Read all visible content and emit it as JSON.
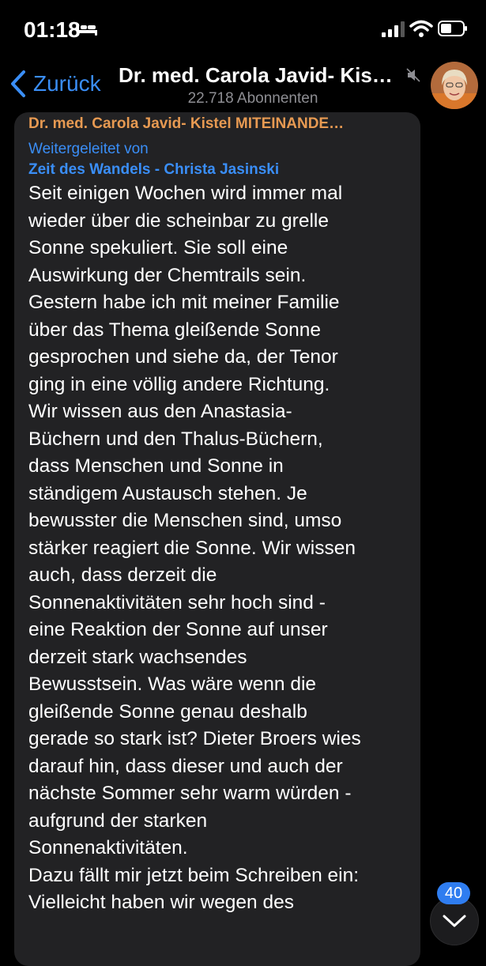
{
  "status_bar": {
    "time": "01:18"
  },
  "header": {
    "back_label": "Zurück",
    "channel_title": "Dr. med. Carola Javid- Kis…",
    "subscribers": "22.718 Abonnenten"
  },
  "message": {
    "sender": "Dr. med. Carola Javid- Kistel MITEINANDE…",
    "forwarded_label": "Weitergeleitet von",
    "forwarded_source": "Zeit des Wandels - Christa Jasinski",
    "lines": [
      "Seit einigen Wochen wird immer mal",
      "wieder über die scheinbar zu grelle",
      "Sonne spekuliert. Sie soll eine",
      "Auswirkung der Chemtrails sein.",
      "Gestern habe ich mit meiner Familie",
      "über das Thema gleißende Sonne",
      "gesprochen und siehe da, der Tenor",
      "ging in eine völlig andere Richtung.",
      "Wir wissen aus den Anastasia-",
      "Büchern und den Thalus-Büchern,",
      "dass Menschen und Sonne in",
      "ständigem Austausch stehen. Je",
      "bewusster die Menschen sind, umso",
      "stärker reagiert die Sonne. Wir wissen",
      "auch, dass derzeit die",
      "Sonnenaktivitäten sehr hoch sind -",
      "eine Reaktion der Sonne auf unser",
      "derzeit stark wachsendes",
      "Bewusstsein. Was wäre wenn die",
      "gleißende Sonne genau deshalb",
      "gerade so stark ist? Dieter Broers wies",
      "darauf hin, dass dieser und auch der",
      "nächste Sommer sehr warm würden -",
      "aufgrund der starken",
      "Sonnenaktivitäten.",
      "Dazu fällt mir jetzt beim Schreiben ein:",
      "Vielleicht haben wir wegen des"
    ]
  },
  "scroll_badge": {
    "count": "40"
  },
  "colors": {
    "accent": "#3a8ef7",
    "sender": "#e79a52",
    "bubble": "#222224",
    "badge": "#2f7df0"
  },
  "icons": [
    "bed-icon",
    "signal-icon",
    "wifi-icon",
    "battery-icon",
    "chevron-left-icon",
    "mute-icon",
    "avatar",
    "chevron-down-icon"
  ]
}
